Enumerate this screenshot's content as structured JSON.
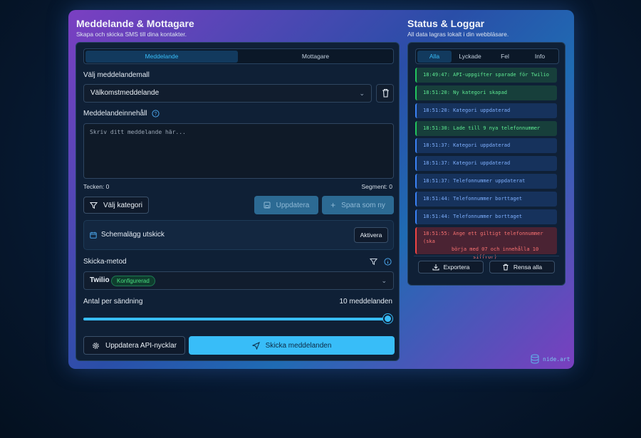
{
  "left": {
    "title": "Meddelande & Mottagare",
    "subtitle": "Skapa och skicka SMS till dina kontakter.",
    "tabs": [
      {
        "label": "Meddelande"
      },
      {
        "label": "Mottagare"
      }
    ],
    "template_label": "Välj meddelandemall",
    "template_value": "Välkomstmeddelande",
    "content_label": "Meddelandeinnehåll",
    "content_placeholder": "Skriv ditt meddelande här...",
    "char_count": "Tecken: 0",
    "segment_count": "Segment: 0",
    "category_button": "Välj kategori",
    "update_button": "Uppdatera",
    "save_new_button": "Spara som ny",
    "schedule_label": "Schemalägg utskick",
    "activate_button": "Aktivera",
    "method_label": "Skicka-metod",
    "method_value": "Twilio",
    "method_badge": "Konfigurerad",
    "per_send_label": "Antal per sändning",
    "per_send_value": "10 meddelanden",
    "per_send_slider_fraction": 1.0,
    "api_button": "Uppdatera API-nycklar",
    "send_button": "Skicka meddelanden"
  },
  "right": {
    "title": "Status & Loggar",
    "subtitle": "All data lagras lokalt i din webbläsare.",
    "tabs": [
      {
        "label": "Alla"
      },
      {
        "label": "Lyckade"
      },
      {
        "label": "Fel"
      },
      {
        "label": "Info"
      }
    ],
    "logs": [
      {
        "type": "success",
        "text": "18:49:47: API-uppgifter sparade för Twilio"
      },
      {
        "type": "success",
        "text": "18:51:20: Ny kategori skapad"
      },
      {
        "type": "info",
        "text": "18:51:20: Kategori uppdaterad"
      },
      {
        "type": "success",
        "text": "18:51:30: Lade till 9 nya telefonnummer"
      },
      {
        "type": "info",
        "text": "18:51:37: Kategori uppdaterad"
      },
      {
        "type": "info",
        "text": "18:51:37: Kategori uppdaterad"
      },
      {
        "type": "info",
        "text": "18:51:37: Telefonnummer uppdaterat"
      },
      {
        "type": "info",
        "text": "18:51:44: Telefonnummer borttaget"
      },
      {
        "type": "info",
        "text": "18:51:44: Telefonnummer borttaget"
      },
      {
        "type": "error",
        "lines": [
          "18:51:55:  Ange ett giltigt telefonnummer (ska",
          "börja med 07 och innehålla 10",
          "siffror)"
        ]
      }
    ],
    "export_button": "Exportera",
    "clear_button": "Rensa alla"
  },
  "brand": "nide.art",
  "colors": {
    "accent": "#38bdf8",
    "success": "#22c55e",
    "info": "#3b82f6",
    "error": "#ef4444"
  }
}
